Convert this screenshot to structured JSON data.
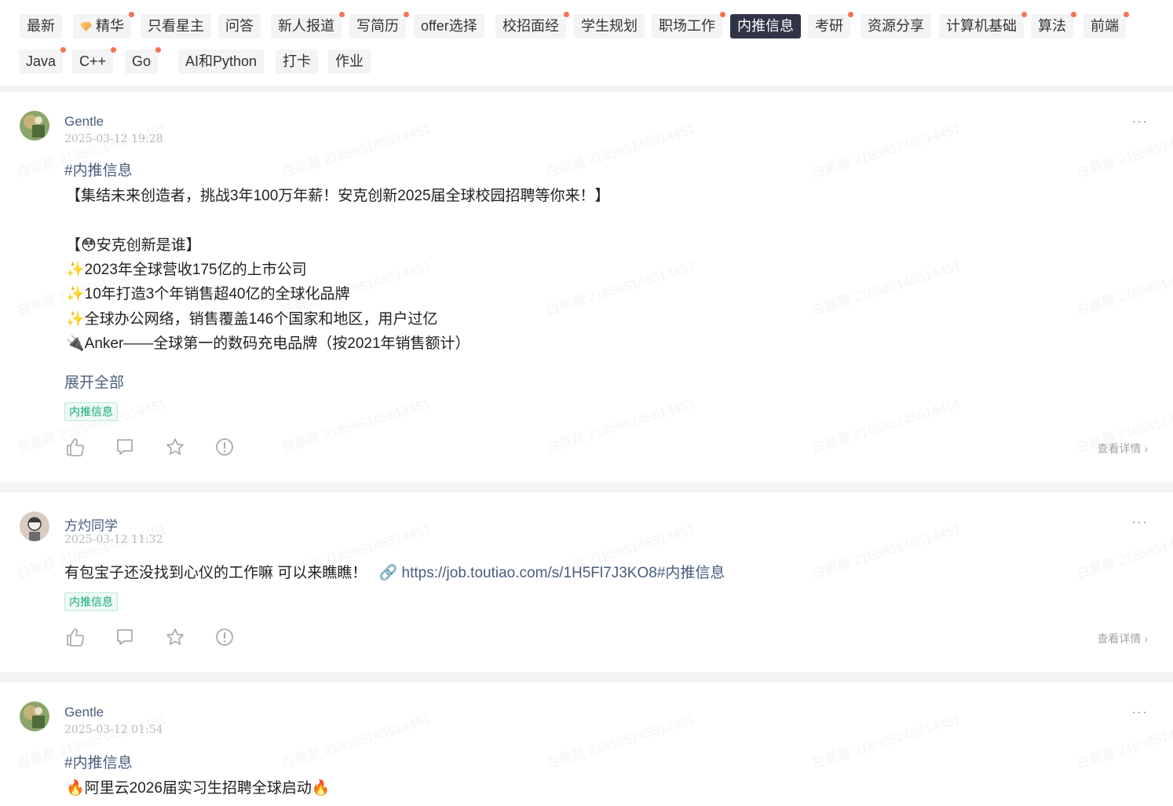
{
  "tabs": [
    {
      "label": "最新",
      "dot": false,
      "active": false
    },
    {
      "label": "精华",
      "dot": true,
      "active": false,
      "gem": true
    },
    {
      "label": "只看星主",
      "dot": false,
      "active": false
    },
    {
      "label": "问答",
      "dot": false,
      "active": false
    },
    {
      "label": "新人报道",
      "dot": true,
      "active": false
    },
    {
      "label": "写简历",
      "dot": true,
      "active": false
    },
    {
      "label": "offer选择",
      "dot": false,
      "active": false
    },
    {
      "label": "校招面经",
      "dot": true,
      "active": false
    },
    {
      "label": "学生规划",
      "dot": false,
      "active": false
    },
    {
      "label": "职场工作",
      "dot": true,
      "active": false
    },
    {
      "label": "内推信息",
      "dot": false,
      "active": true
    },
    {
      "label": "考研",
      "dot": true,
      "active": false
    },
    {
      "label": "资源分享",
      "dot": false,
      "active": false
    },
    {
      "label": "计算机基础",
      "dot": true,
      "active": false
    },
    {
      "label": "算法",
      "dot": true,
      "active": false
    },
    {
      "label": "前端",
      "dot": true,
      "active": false
    },
    {
      "label": "Java",
      "dot": true,
      "active": false
    },
    {
      "label": "C++",
      "dot": true,
      "active": false
    },
    {
      "label": "Go",
      "dot": true,
      "active": false
    },
    {
      "label": "AI和Python",
      "dot": false,
      "active": false
    },
    {
      "label": "打卡",
      "dot": false,
      "active": false
    },
    {
      "label": "作业",
      "dot": false,
      "active": false
    }
  ],
  "watermark": "白晨晨 218585145514451",
  "posts": [
    {
      "author": "Gentle",
      "time": "2025-03-12 19:28",
      "hashtag": "#内推信息",
      "lines": [
        "【集结未来创造者，挑战3年100万年薪！安克创新2025届全球校园招聘等你来！】",
        "【😳安克创新是谁】",
        "✨2023年全球营收175亿的上市公司",
        "✨10年打造3个年销售超40亿的全球化品牌",
        "✨全球办公网络，销售覆盖146个国家和地区，用户过亿",
        "🔌Anker——全球第一的数码充电品牌（按2021年销售额计）"
      ],
      "expand": "展开全部",
      "tag": "内推信息",
      "detail": "查看详情",
      "more": "···"
    },
    {
      "author": "方灼同学",
      "time": "2025-03-12 11:32",
      "text": "有包宝子还没找到心仪的工作嘛 可以来瞧瞧！",
      "link": "https://job.toutiao.com/s/1H5Fl7J3KO8#内推信息",
      "tag": "内推信息",
      "detail": "查看详情",
      "more": "···"
    },
    {
      "author": "Gentle",
      "time": "2025-03-12 01:54",
      "hashtag": "#内推信息",
      "lines": [
        "🔥阿里云2026届实习生招聘全球启动🔥"
      ],
      "more": "···"
    }
  ]
}
